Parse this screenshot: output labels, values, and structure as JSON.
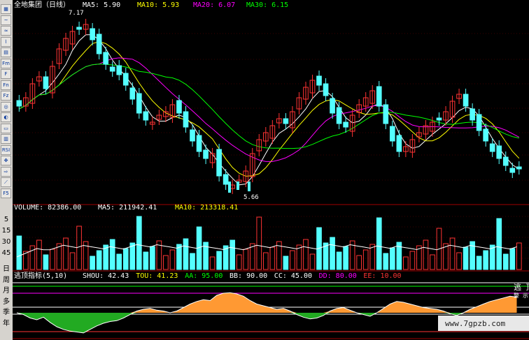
{
  "toolbar": {
    "buttons": [
      "▦",
      "~",
      "≈",
      "⌇",
      "▤",
      "Fm",
      "F",
      "Fn",
      "Fz",
      "◎",
      "◐",
      "▭",
      "▥",
      "RSI",
      "✥",
      "⇨",
      "⟋",
      "F5"
    ],
    "labels": [
      "日",
      "周",
      "月",
      "多",
      "季",
      "年"
    ]
  },
  "main": {
    "title": "全地集团（日线）",
    "ma": [
      {
        "label": "MA5: 5.90",
        "color": "#ffffff"
      },
      {
        "label": "MA10: 5.93",
        "color": "#ffff00"
      },
      {
        "label": "MA20: 6.07",
        "color": "#ff00ff"
      },
      {
        "label": "MA30: 6.15",
        "color": "#00ff00"
      }
    ],
    "high_label": "7.17",
    "low_label": "5.66"
  },
  "volume": {
    "label": "VOLUME: 82386.00",
    "ma5": "MA5: 211942.41",
    "ma10": "MA10: 213318.41",
    "axis": [
      "5",
      "15",
      "30",
      "45"
    ]
  },
  "indicator": {
    "label": "逃顶指标(5,10)",
    "items": [
      {
        "text": "SHOU: 42.43",
        "color": "#ffffff"
      },
      {
        "text": "TOU: 41.23",
        "color": "#ffff00"
      },
      {
        "text": "AA: 95.00",
        "color": "#00ff00"
      },
      {
        "text": "BB: 90.00",
        "color": "#ffffff"
      },
      {
        "text": "CC: 45.00",
        "color": "#ffffff"
      },
      {
        "text": "DD: 80.00",
        "color": "#ff00ff"
      },
      {
        "text": "EE: 10.00",
        "color": "#ff3333"
      }
    ],
    "side_label": "逃 顶",
    "side_sub": "警 示"
  },
  "watermark": "www.7gpzb.com",
  "colors": {
    "up": "#ff3333",
    "down": "#54ffff",
    "orange": "#ff9933",
    "green": "#22aa22"
  }
}
